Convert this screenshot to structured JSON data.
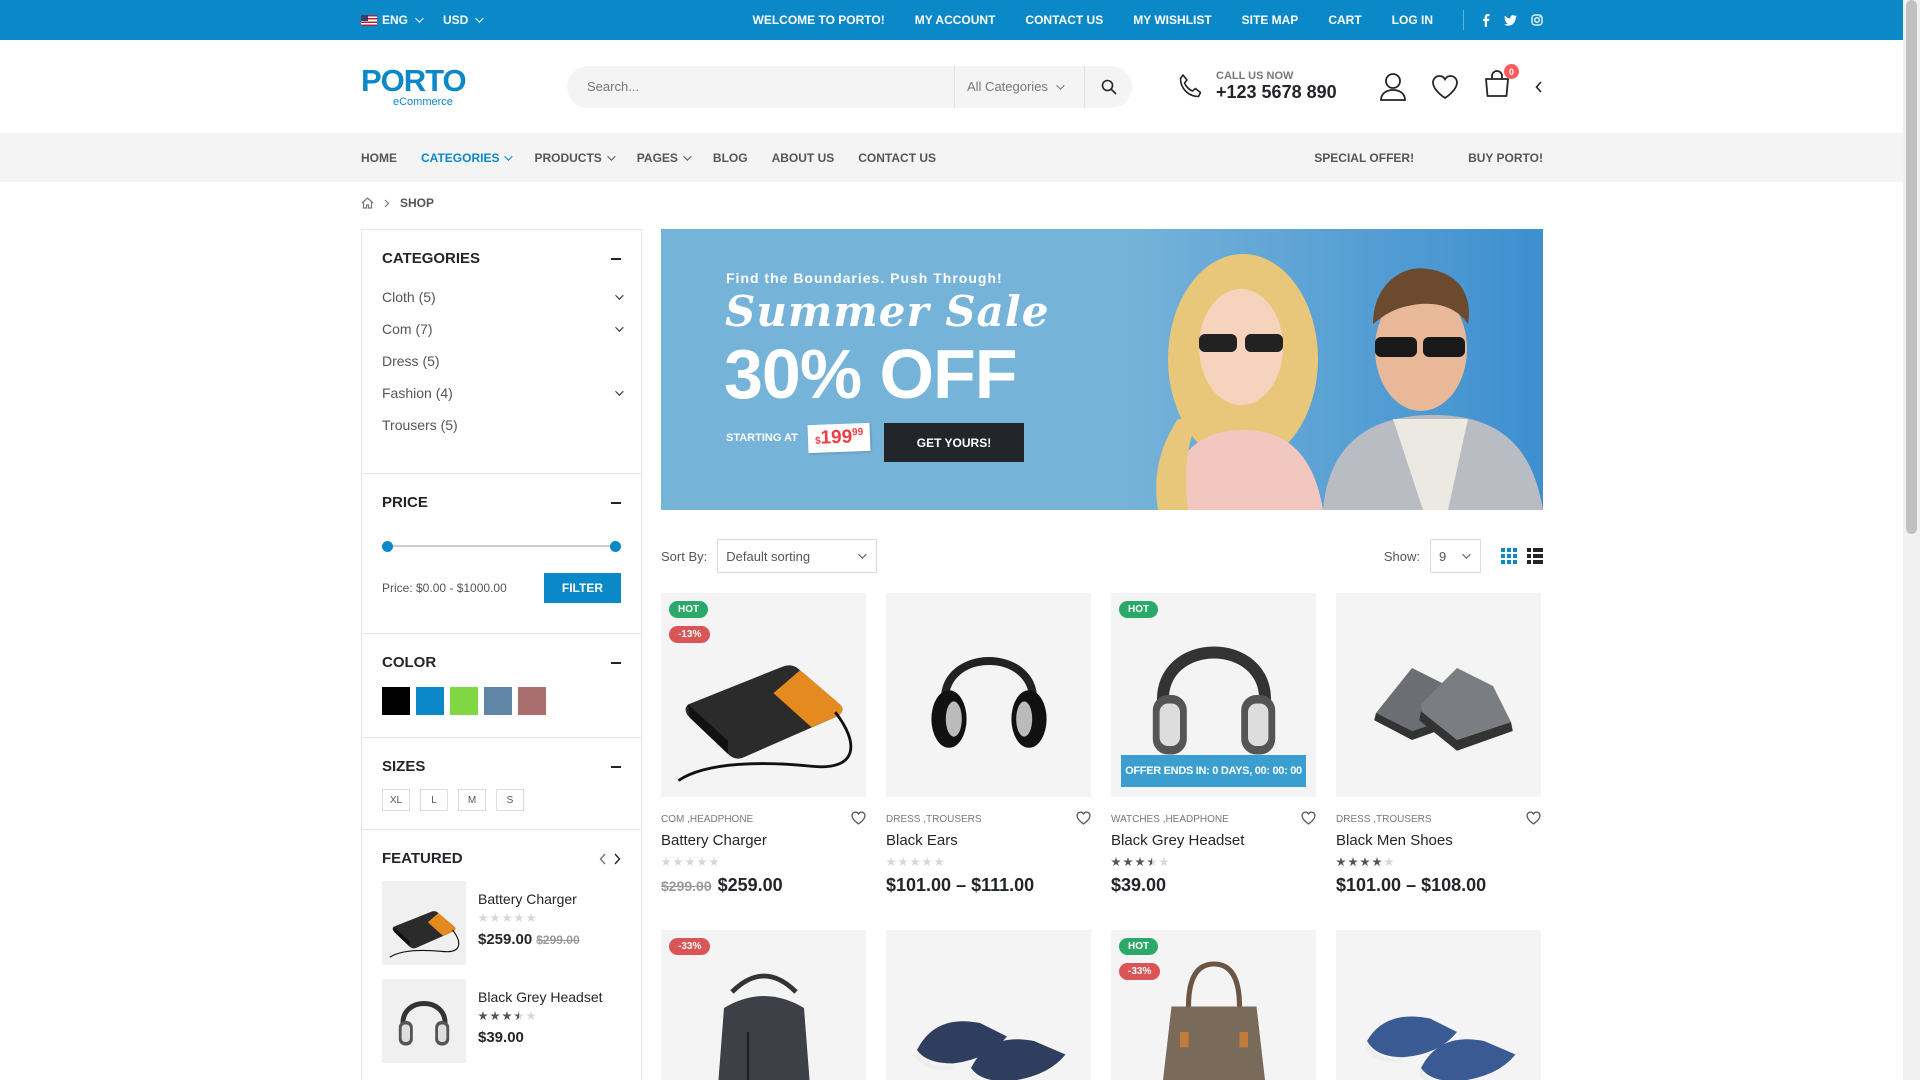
{
  "topbar": {
    "lang": "ENG",
    "currency": "USD",
    "links": [
      "WELCOME TO PORTO!",
      "MY ACCOUNT",
      "CONTACT US",
      "MY WISHLIST",
      "SITE MAP",
      "CART",
      "LOG IN"
    ],
    "social": [
      "facebook-icon",
      "twitter-icon",
      "instagram-icon"
    ],
    "bg_color": "#0b88c7"
  },
  "header": {
    "logo": "PORTO",
    "logo_sub": "eCommerce",
    "search_placeholder": "Search...",
    "category_select": "All Categories",
    "call_label": "CALL US NOW",
    "call_number": "+123 5678 890",
    "cart_count": "0"
  },
  "nav": {
    "items": [
      "HOME",
      "CATEGORIES",
      "PRODUCTS",
      "PAGES",
      "BLOG",
      "ABOUT US",
      "CONTACT US"
    ],
    "right": [
      "SPECIAL OFFER!",
      "BUY PORTO!"
    ],
    "active": "CATEGORIES"
  },
  "breadcrumb": {
    "current": "SHOP"
  },
  "sidebar": {
    "categories_title": "CATEGORIES",
    "categories": [
      {
        "label": "Cloth (5)",
        "expandable": true
      },
      {
        "label": "Com (7)",
        "expandable": true
      },
      {
        "label": "Dress (5)",
        "expandable": false
      },
      {
        "label": "Fashion (4)",
        "expandable": true
      },
      {
        "label": "Trousers (5)",
        "expandable": false
      }
    ],
    "price_title": "PRICE",
    "price_text": "Price: $0.00 - $1000.00",
    "filter_label": "FILTER",
    "color_title": "COLOR",
    "colors": [
      "#000000",
      "#0b88c7",
      "#81d742",
      "#6085a5",
      "#ab6e6e"
    ],
    "sizes_title": "SIZES",
    "sizes": [
      "XL",
      "L",
      "M",
      "S"
    ],
    "featured_title": "FEATURED",
    "featured": [
      {
        "name": "Battery Charger",
        "price": "$259.00",
        "old": "$299.00",
        "rating": 0
      },
      {
        "name": "Black Grey Headset",
        "price": "$39.00",
        "old": "",
        "rating": 3.5
      }
    ]
  },
  "banner": {
    "tagline": "Find the Boundaries. Push Through!",
    "title": "Summer Sale",
    "offer": "30% OFF",
    "starting": "STARTING AT",
    "price_dollar": "$",
    "price_main": "199",
    "price_cents": "99",
    "cta": "GET YOURS!"
  },
  "toolbar": {
    "sort_label": "Sort By:",
    "sort_value": "Default sorting",
    "show_label": "Show:",
    "show_value": "9"
  },
  "products": [
    {
      "cats": "COM ,HEADPHONE",
      "name": "Battery Charger",
      "price": "$259.00",
      "old": "$299.00",
      "rating": 0,
      "labels": [
        "HOT",
        "-13%"
      ],
      "img": "battery"
    },
    {
      "cats": "DRESS ,TROUSERS",
      "name": "Black Ears",
      "price": "$101.00 – $111.00",
      "old": "",
      "rating": 0,
      "labels": [],
      "img": "headphone"
    },
    {
      "cats": "WATCHES ,HEADPHONE",
      "name": "Black Grey Headset",
      "price": "$39.00",
      "old": "",
      "rating": 3.5,
      "labels": [
        "HOT"
      ],
      "img": "headset",
      "offer": "OFFER ENDS IN: 0 DAYS, 00: 00: 00"
    },
    {
      "cats": "DRESS ,TROUSERS",
      "name": "Black Men Shoes",
      "price": "$101.00 – $108.00",
      "old": "",
      "rating": 4,
      "labels": [],
      "img": "sneaker"
    },
    {
      "cats": "",
      "name": "",
      "price": "",
      "old": "",
      "rating": 0,
      "labels": [
        "-33%"
      ],
      "img": "backpack"
    },
    {
      "cats": "",
      "name": "",
      "price": "",
      "old": "",
      "rating": 0,
      "labels": [],
      "img": "loafer"
    },
    {
      "cats": "",
      "name": "",
      "price": "",
      "old": "",
      "rating": 0,
      "labels": [
        "HOT",
        "-33%"
      ],
      "img": "bag"
    },
    {
      "cats": "",
      "name": "",
      "price": "",
      "old": "",
      "rating": 0,
      "labels": [],
      "img": "oxford"
    }
  ]
}
